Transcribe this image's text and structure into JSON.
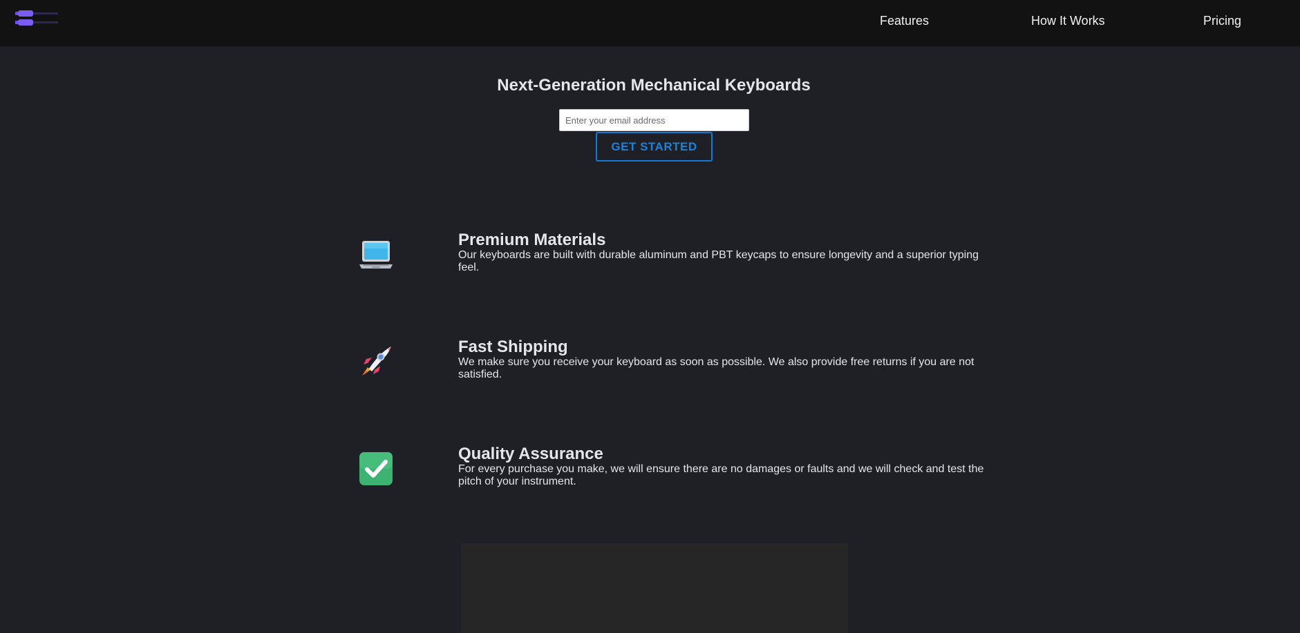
{
  "nav": {
    "logo_icon": "keyboard-plug-logo-icon",
    "links": [
      {
        "label": "Features"
      },
      {
        "label": "How It Works"
      },
      {
        "label": "Pricing"
      }
    ]
  },
  "hero": {
    "title": "Next-Generation Mechanical Keyboards",
    "email_placeholder": "Enter your email address",
    "email_value": "",
    "cta_label": "GET STARTED"
  },
  "features": [
    {
      "icon": "laptop-icon",
      "title": "Premium Materials",
      "description": "Our keyboards are built with durable aluminum and PBT keycaps to ensure longevity and a superior typing feel."
    },
    {
      "icon": "rocket-icon",
      "title": "Fast Shipping",
      "description": "We make sure you receive your keyboard as soon as possible. We also provide free returns if you are not satisfied."
    },
    {
      "icon": "check-box-icon",
      "title": "Quality Assurance",
      "description": "For every purchase you make, we will ensure there are no damages or faults and we will check and test the pitch of your instrument."
    }
  ],
  "colors": {
    "background": "#1f1f26",
    "nav_background": "#121212",
    "accent": "#1684e0",
    "logo_purple": "#7b5cf0",
    "check_green": "#3cb371"
  }
}
